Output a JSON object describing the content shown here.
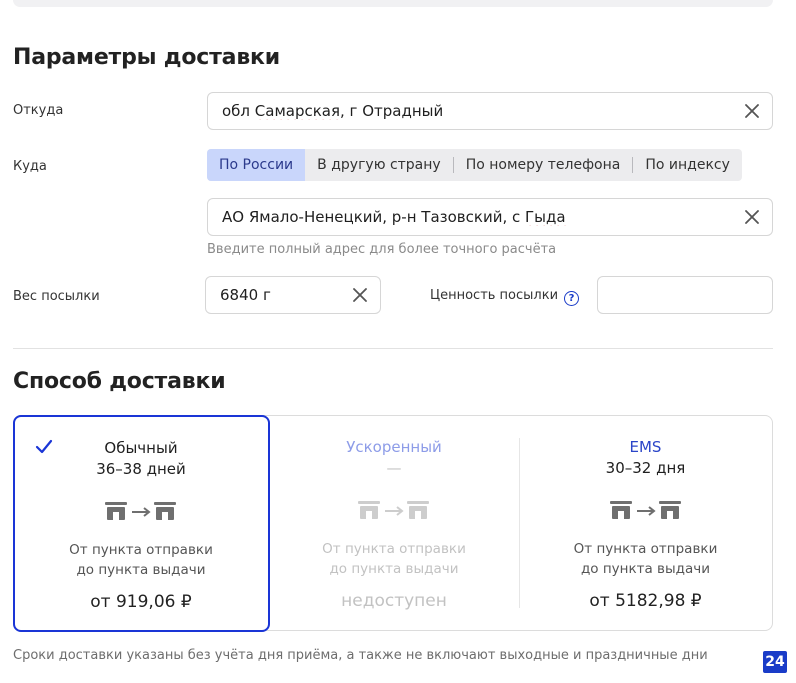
{
  "delivery_params": {
    "title": "Параметры доставки",
    "from_label": "Откуда",
    "from_value_prefix": "обл ",
    "from_value_spell": "Самарская",
    "from_value_suffix": ", г Отрадный",
    "to_label": "Куда",
    "tabs": [
      {
        "label": "По России",
        "active": true
      },
      {
        "label": "В другую страну",
        "active": false
      },
      {
        "label": "По номеру телефона",
        "active": false
      },
      {
        "label": "По индексу",
        "active": false
      }
    ],
    "to_value_prefix": "АО Ямало-Ненецкий, р-н Тазовский, с ",
    "to_value_spell": "Гыда",
    "to_hint": "Введите полный адрес для более точного расчёта",
    "weight_label": "Вес посылки",
    "weight_value": "6840 г",
    "value_label": "Ценность посылки",
    "value_info_icon": "?",
    "value_input": ""
  },
  "delivery_method": {
    "title": "Способ доставки",
    "methods": [
      {
        "name": "Обычный",
        "days": "36–38 дней",
        "desc_line1": "От пункта отправки",
        "desc_line2": "до пункта выдачи",
        "price": "от 919,06 ₽",
        "selected": true,
        "available": true
      },
      {
        "name": "Ускоренный",
        "days": "—",
        "desc_line1": "От пункта отправки",
        "desc_line2": "до пункта выдачи",
        "price": "недоступен",
        "selected": false,
        "available": false
      },
      {
        "name": "EMS",
        "days": "30–32 дня",
        "desc_line1": "От пункта отправки",
        "desc_line2": "до пункта выдачи",
        "price": "от 5182,98 ₽",
        "selected": false,
        "available": true
      }
    ]
  },
  "footnote": "Сроки доставки указаны без учёта дня приёма, а также не включают выходные и праздничные дни",
  "badge": "24",
  "colors": {
    "accent": "#1a35d6",
    "tab_active_bg": "#c9d6fb",
    "disabled_text": "#c2c2c2"
  },
  "icons": {
    "clear": "close-icon",
    "check": "checkmark-icon",
    "route": "branch-to-branch-icon"
  }
}
